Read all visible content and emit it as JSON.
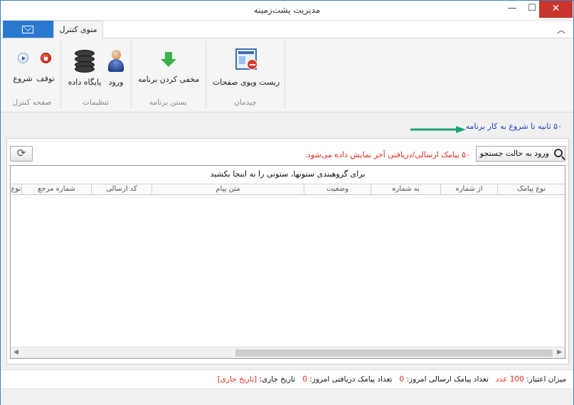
{
  "window": {
    "title": "مدیریت پشت‌زمینه",
    "minimize_glyph": "—",
    "maximize_glyph": "☐",
    "close_glyph": "✕"
  },
  "tabs": {
    "active_label": "منوی کنترل",
    "mail_tab_icon": "envelope-icon",
    "collapse_glyph": "︿"
  },
  "ribbon": {
    "groups": [
      {
        "label": "صفحه کنترل",
        "buttons": [
          {
            "label": "شروع",
            "icon": "play-icon"
          },
          {
            "label": "توقف",
            "icon": "stop-icon"
          }
        ]
      },
      {
        "label": "تنظیمات",
        "buttons": [
          {
            "label": "پایگاه داده",
            "icon": "database-icon"
          },
          {
            "label": "ورود",
            "icon": "user-icon"
          }
        ]
      },
      {
        "label": "بستن برنامه",
        "buttons": [
          {
            "label": "مخفی کردن برنامه",
            "icon": "download-arrow-icon"
          }
        ]
      },
      {
        "label": "چیدمان",
        "buttons": [
          {
            "label": "ریست ویوی صفحات",
            "icon": "reset-layout-icon"
          }
        ]
      }
    ]
  },
  "countdown": {
    "text": "۵۰ ثانیه تا شروع به کار برنامه",
    "arrow_color": "#1aa37a"
  },
  "toolbar": {
    "search_mode_label": "ورود به حالت جستجو",
    "refresh_glyph": "⟳",
    "sms_note": "۵۰ پیامک ارسالی/دریافتی آخر نمایش داده می‌شود."
  },
  "grid": {
    "group_panel_text": "برای گروهبندی ستونها، ستونی را به اینجا بکشید",
    "columns": [
      "نوع پیامک",
      "از شماره",
      "به شماره",
      "وضعیت",
      "متن پیام",
      "کد ارسالی",
      "شماره مرجع",
      "نوع"
    ]
  },
  "status": {
    "credit_label": "میزان اعتبار:",
    "credit_value": "100",
    "credit_unit": "عدد",
    "sent_label": "تعداد پیامک ارسالی امروز:",
    "sent_value": "0",
    "received_label": "تعداد پیامک دریافتی امروز:",
    "received_value": "0",
    "date_label": "تاریخ جاری:",
    "date_value": "[تاریخ جاری]"
  },
  "colors": {
    "accent": "#2b78d0",
    "close": "#c7352c",
    "warning_text": "#e02e1e",
    "countdown_text": "#1f3dbd"
  }
}
